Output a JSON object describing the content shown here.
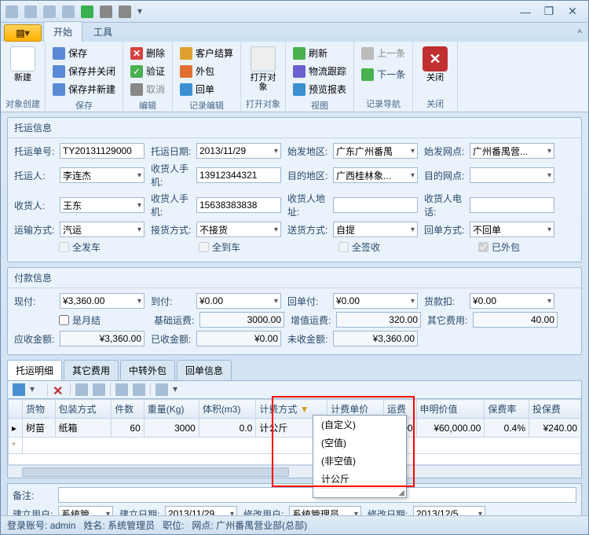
{
  "tabs": {
    "orb": "▤▾",
    "start": "开始",
    "tools": "工具"
  },
  "ribbon": {
    "create": {
      "new": "新建",
      "group": "对象创建"
    },
    "save": {
      "save": "保存",
      "saveclose": "保存并关闭",
      "savenew": "保存并新建",
      "group": "保存"
    },
    "edit": {
      "del": "删除",
      "verify": "验证",
      "cancel": "取消",
      "group": "编辑"
    },
    "rec": {
      "cust": "客户结算",
      "ext": "外包",
      "back": "回单",
      "group": "记录编辑"
    },
    "open": {
      "open": "打开对象",
      "group": "打开对象"
    },
    "view": {
      "refresh": "刷新",
      "trace": "物流跟踪",
      "report": "预览报表",
      "group": "视图"
    },
    "nav": {
      "prev": "上一条",
      "next": "下一条",
      "group": "记录导航"
    },
    "close": {
      "close": "关闭",
      "group": "关闭"
    }
  },
  "ship": {
    "title": "托运信息",
    "no_lbl": "托运单号:",
    "no": "TY20131129000",
    "date_lbl": "托运日期:",
    "date": "2013/11/29",
    "from_lbl": "始发地区:",
    "from": "广东广州番禺",
    "fromnet_lbl": "始发网点:",
    "fromnet": "广州番禺营...",
    "shipper_lbl": "托运人:",
    "shipper": "李连杰",
    "shipper_ph_lbl": "收货人手机:",
    "shipper_ph": "13912344321",
    "dest_lbl": "目的地区:",
    "dest": "广西桂林象...",
    "destnet_lbl": "目的网点:",
    "destnet": "",
    "recv_lbl": "收货人:",
    "recv": "王东",
    "recv_ph_lbl": "收货人手机:",
    "recv_ph": "15638383838",
    "recv_addr_lbl": "收货人地址:",
    "recv_addr": "",
    "recv_tel_lbl": "收货人电话:",
    "recv_tel": "",
    "trans_lbl": "运输方式:",
    "trans": "汽运",
    "pick_lbl": "接货方式:",
    "pick": "不接货",
    "deliv_lbl": "送货方式:",
    "deliv": "自提",
    "receipt_lbl": "回单方式:",
    "receipt": "不回单",
    "chk_allship": "全发车",
    "chk_allarrive": "全到车",
    "chk_allsign": "全签收",
    "chk_ext": "已外包"
  },
  "pay": {
    "title": "付款信息",
    "cash_lbl": "现付:",
    "cash": "¥3,360.00",
    "cod_lbl": "到付:",
    "cod": "¥0.00",
    "receipt_lbl": "回单付:",
    "receipt": "¥0.00",
    "disc_lbl": "货款扣:",
    "disc": "¥0.00",
    "monthly": "是月结",
    "base_lbl": "基础运费:",
    "base": "3000.00",
    "add_lbl": "增值运费:",
    "add": "320.00",
    "other_lbl": "其它费用:",
    "other": "40.00",
    "due_lbl": "应收金额:",
    "due": "¥3,360.00",
    "got_lbl": "已收金额:",
    "got": "¥0.00",
    "left_lbl": "未收金额:",
    "left": "¥3,360.00"
  },
  "dtabs": {
    "t1": "托运明细",
    "t2": "其它费用",
    "t3": "中转外包",
    "t4": "回单信息"
  },
  "grid": {
    "cols": {
      "goods": "货物",
      "pack": "包装方式",
      "qty": "件数",
      "wt": "重量(Kg)",
      "vol": "体积(m3)",
      "bill": "计费方式",
      "price": "计费单价",
      "fee": "运费",
      "decl": "申明价值",
      "rate": "保费率",
      "ins": "投保费"
    },
    "row": {
      "goods": "树苗",
      "pack": "纸箱",
      "qty": "60",
      "wt": "3000",
      "vol": "0.0",
      "bill": "计公斤",
      "fee": "0.00",
      "decl": "¥60,000.00",
      "rate": "0.4%",
      "ins": "¥240.00"
    }
  },
  "dd": {
    "i1": "(自定义)",
    "i2": "(空值)",
    "i3": "(非空值)",
    "i4": "计公斤"
  },
  "btm": {
    "remark_lbl": "备注:",
    "cuser_lbl": "建立用户:",
    "cuser": "系统管...",
    "cdate_lbl": "建立日期:",
    "cdate": "2013/11/29",
    "muser_lbl": "修改用户:",
    "muser": "系统管理员",
    "mdate_lbl": "修改日期:",
    "mdate": "2013/12/5"
  },
  "status": {
    "acct_lbl": "登录账号:",
    "acct": "admin",
    "name_lbl": "姓名:",
    "name": "系统管理员",
    "pos_lbl": "职位:",
    "net_lbl": "网点:",
    "net": "广州番禺营业部(总部)"
  }
}
